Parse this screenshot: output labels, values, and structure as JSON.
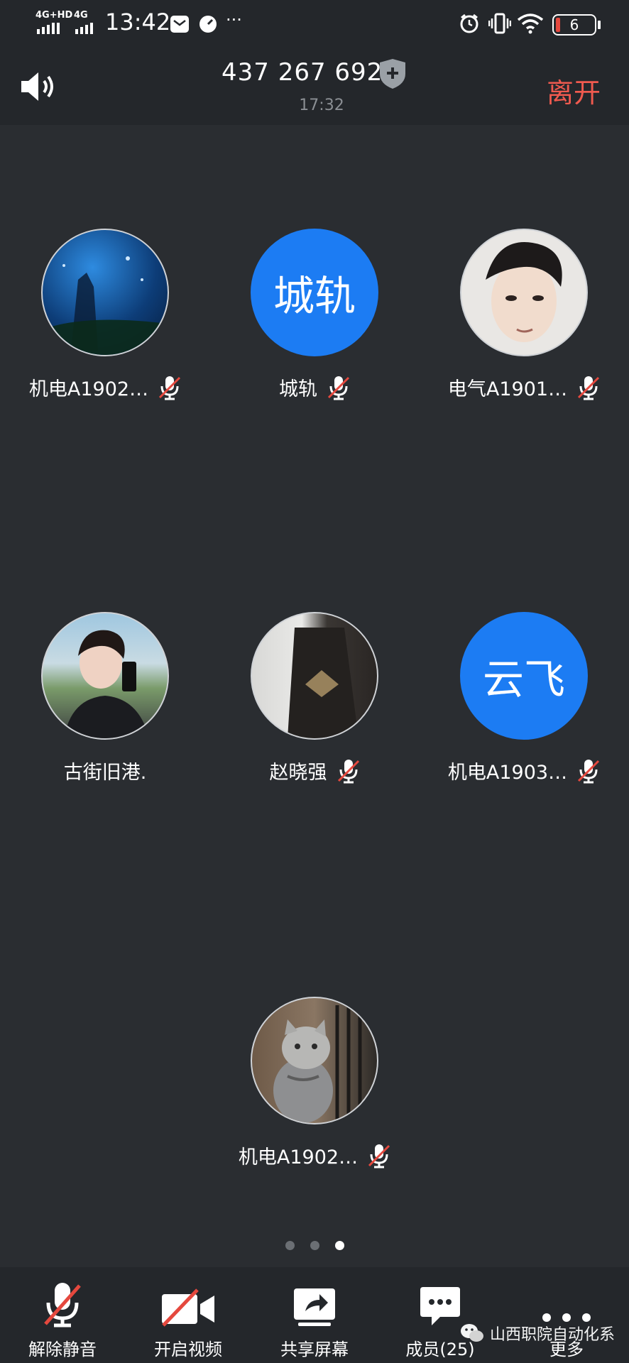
{
  "status_bar": {
    "network1": "4G+HD",
    "network2": "4G",
    "time": "13:42",
    "more": "···",
    "battery": "6"
  },
  "header": {
    "meeting_id": "437 267 692",
    "elapsed": "17:32",
    "leave_label": "离开"
  },
  "participants": [
    {
      "name": "机电A1902…",
      "avatar_type": "photo",
      "muted": true
    },
    {
      "name": "城轨",
      "avatar_type": "text",
      "avatar_text": "城轨",
      "muted": true
    },
    {
      "name": "电气A1901…",
      "avatar_type": "photo",
      "muted": true
    },
    {
      "name": "古街旧港.",
      "avatar_type": "photo",
      "muted": false
    },
    {
      "name": "赵晓强",
      "avatar_type": "photo",
      "muted": true
    },
    {
      "name": "机电A1903…",
      "avatar_type": "text",
      "avatar_text": "云飞",
      "muted": true
    },
    {
      "name": "机电A1902…",
      "avatar_type": "photo",
      "muted": true
    }
  ],
  "pager": {
    "total": 3,
    "active": 3
  },
  "toolbar": {
    "unmute": "解除静音",
    "video": "开启视频",
    "share": "共享屏幕",
    "members": "成员(25)",
    "more": "更多"
  },
  "watermark": "山西职院自动化系",
  "colors": {
    "accent_blue": "#1c7cf3",
    "leave_red": "#f05a4f",
    "mute_red": "#e5483e",
    "background": "#2a2d31"
  }
}
